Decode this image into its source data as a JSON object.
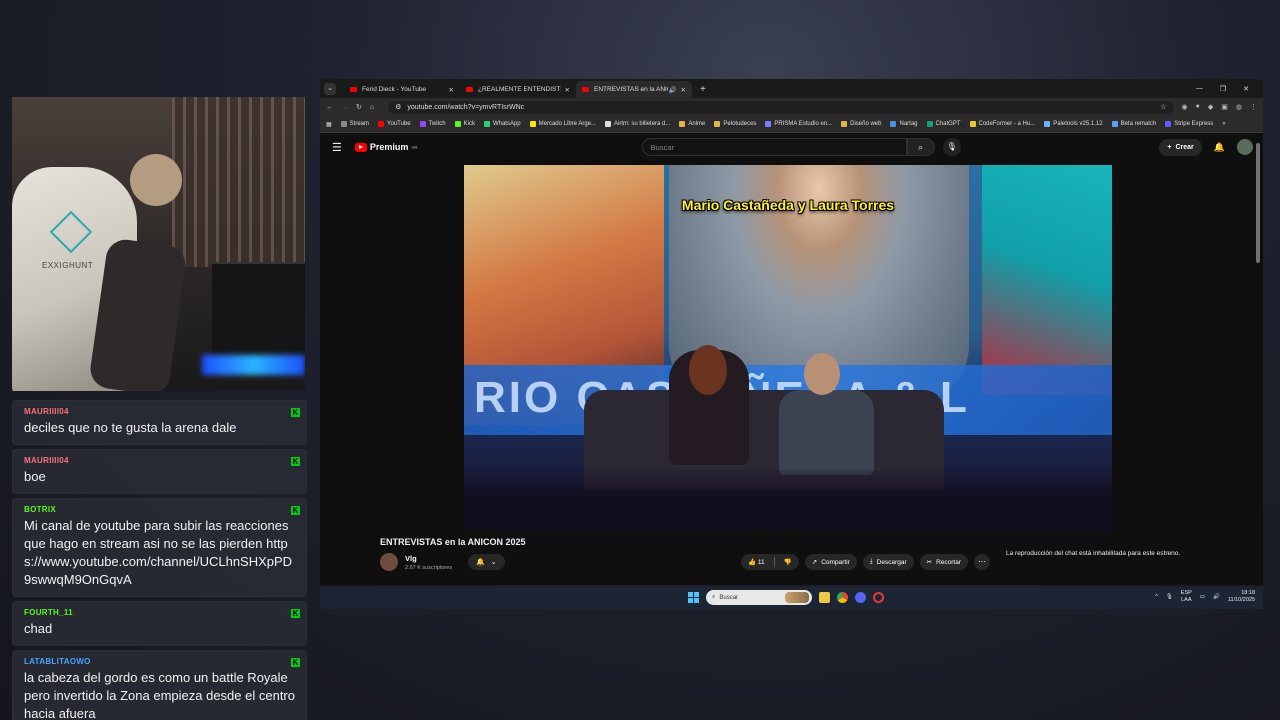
{
  "chat": {
    "messages": [
      {
        "user": "MAURIIII04",
        "color": "#ff6e7a",
        "text": "deciles que no te gusta la arena dale"
      },
      {
        "user": "MAURIIII04",
        "color": "#ff6e7a",
        "text": "boe"
      },
      {
        "user": "BOTRIX",
        "color": "#53fc18",
        "text": "Mi canal de youtube para subir las reacciones que hago en stream asi no se las pierden https://www.youtube.com/channel/UCLhnSHXpPD9swwqM9OnGqvA"
      },
      {
        "user": "FOURTH_11",
        "color": "#53fc18",
        "text": "chad"
      },
      {
        "user": "LATABLITAOWO",
        "color": "#4aa3ff",
        "text": "la cabeza del gordo es como un battle Royale pero invertido la Zona empieza desde el centro hacia afuera"
      }
    ]
  },
  "cam": {
    "brand": "EXXIGHUNT"
  },
  "browser": {
    "tabs": [
      {
        "label": "Ferid Dieck - YouTube",
        "active": false
      },
      {
        "label": "¿REALMENTE ENTENDISTE qué",
        "active": false
      },
      {
        "label": "ENTREVISTAS en la ANICON",
        "active": true
      }
    ],
    "url": "youtube.com/watch?v=ymvRTIsrWNc",
    "bookmarks": [
      "Stream",
      "YouTube",
      "Twitch",
      "Kick",
      "WhatsApp",
      "Mercado Libre Arge...",
      "Airtm: su billetera d...",
      "Anime",
      "Pelotudeces",
      "PRISMA Estudio en...",
      "Diseño web",
      "Nartag",
      "ChatGPT",
      "CodeFormer - a Hu...",
      "Paletools v25.1.12",
      "Beta rematch",
      "Stripe Express"
    ]
  },
  "youtube": {
    "logo": "Premium",
    "logo_sup": "AR",
    "search_placeholder": "Buscar",
    "create_label": "Crear",
    "caption": "Mario Castañeda y Laura Torres",
    "banner_text": "RIO CASTAÑEDA & L",
    "video_title": "ENTREVISTAS en la ANICON 2025",
    "channel_name": "Vlg",
    "channel_subs": "2.67 K suscriptores",
    "likes": "11",
    "share_label": "Compartir",
    "download_label": "Descargar",
    "clip_label": "Recortar",
    "chat_disabled": "La reproducción del chat está inhabilitada para este estreno."
  },
  "taskbar": {
    "search_placeholder": "Buscar",
    "lang_top": "ESP",
    "lang_bottom": "LAA",
    "time": "18:18",
    "date": "11/10/2025"
  }
}
